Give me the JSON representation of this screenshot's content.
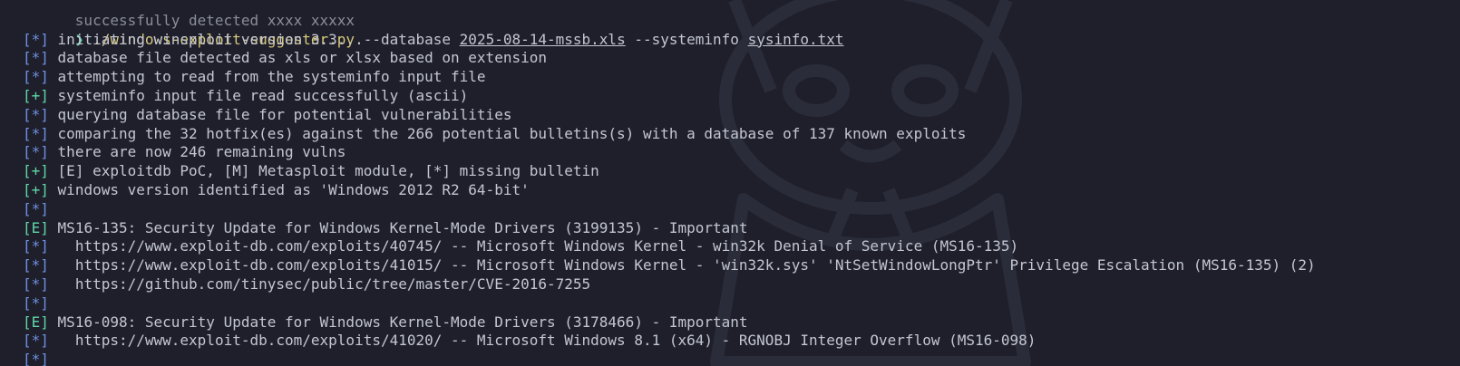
{
  "terminal": {
    "top_partial": "successfully detected xxxx xxxxx",
    "command": {
      "prompt": "❯",
      "program": "./windows-exploit-suggester.py",
      "flag_db": "--database",
      "db_file": "2025-08-14-mssb.xls",
      "flag_sys": "--systeminfo",
      "sys_file": "sysinfo.txt"
    },
    "lines": [
      {
        "tag": "[*]",
        "text": "initiating winsploit version 3.3..."
      },
      {
        "tag": "[*]",
        "text": "database file detected as xls or xlsx based on extension"
      },
      {
        "tag": "[*]",
        "text": "attempting to read from the systeminfo input file"
      },
      {
        "tag": "[+]",
        "text": "systeminfo input file read successfully (ascii)"
      },
      {
        "tag": "[*]",
        "text": "querying database file for potential vulnerabilities"
      },
      {
        "tag": "[*]",
        "text": "comparing the 32 hotfix(es) against the 266 potential bulletins(s) with a database of 137 known exploits"
      },
      {
        "tag": "[*]",
        "text": "there are now 246 remaining vulns"
      },
      {
        "tag": "[+]",
        "text": "[E] exploitdb PoC, [M] Metasploit module, [*] missing bulletin"
      },
      {
        "tag": "[+]",
        "text": "windows version identified as 'Windows 2012 R2 64-bit'"
      },
      {
        "tag": "[*]",
        "text": ""
      },
      {
        "tag": "[E]",
        "text": "MS16-135: Security Update for Windows Kernel-Mode Drivers (3199135) - Important"
      },
      {
        "tag": "[*]",
        "text": "  https://www.exploit-db.com/exploits/40745/ -- Microsoft Windows Kernel - win32k Denial of Service (MS16-135)"
      },
      {
        "tag": "[*]",
        "text": "  https://www.exploit-db.com/exploits/41015/ -- Microsoft Windows Kernel - 'win32k.sys' 'NtSetWindowLongPtr' Privilege Escalation (MS16-135) (2)"
      },
      {
        "tag": "[*]",
        "text": "  https://github.com/tinysec/public/tree/master/CVE-2016-7255"
      },
      {
        "tag": "[*]",
        "text": ""
      },
      {
        "tag": "[E]",
        "text": "MS16-098: Security Update for Windows Kernel-Mode Drivers (3178466) - Important"
      },
      {
        "tag": "[*]",
        "text": "  https://www.exploit-db.com/exploits/41020/ -- Microsoft Windows 8.1 (x64) - RGNOBJ Integer Overflow (MS16-098)"
      },
      {
        "tag": "[*]",
        "text": ""
      }
    ]
  },
  "colors": {
    "background": "#1e1f2b",
    "tag_info": "#6f8fe0",
    "tag_success": "#5fd7a7",
    "command": "#d8c97a",
    "text": "#c3c6d2"
  }
}
